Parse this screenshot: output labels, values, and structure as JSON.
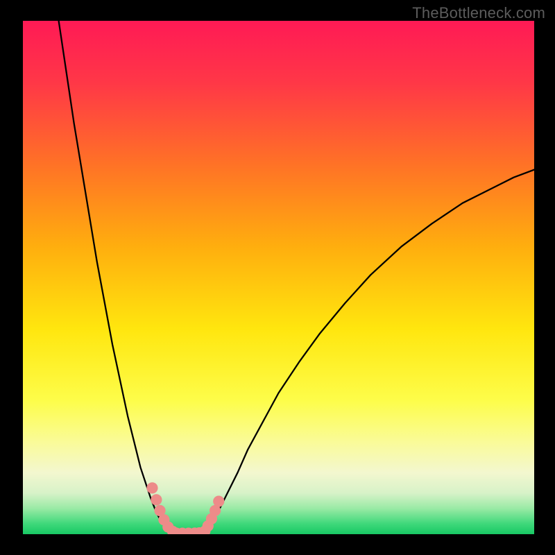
{
  "watermark": "TheBottleneck.com",
  "chart_data": {
    "type": "line",
    "title": "",
    "xlabel": "",
    "ylabel": "",
    "xlim": [
      0,
      100
    ],
    "ylim": [
      0,
      100
    ],
    "grid": false,
    "legend": false,
    "background": {
      "kind": "vertical-gradient",
      "stops": [
        {
          "pct": 0,
          "color": "#ff1a55"
        },
        {
          "pct": 12,
          "color": "#ff3747"
        },
        {
          "pct": 28,
          "color": "#ff7226"
        },
        {
          "pct": 44,
          "color": "#ffae0e"
        },
        {
          "pct": 60,
          "color": "#ffe60e"
        },
        {
          "pct": 74,
          "color": "#fdfd4a"
        },
        {
          "pct": 82,
          "color": "#fafb98"
        },
        {
          "pct": 88,
          "color": "#f3f7cf"
        },
        {
          "pct": 92,
          "color": "#d7f2c8"
        },
        {
          "pct": 95,
          "color": "#99eaa5"
        },
        {
          "pct": 98,
          "color": "#3ed87a"
        },
        {
          "pct": 100,
          "color": "#18c864"
        }
      ]
    },
    "series": [
      {
        "name": "curve-left",
        "color": "#000000",
        "x": [
          7.0,
          8.5,
          10.0,
          11.5,
          13.0,
          14.5,
          16.0,
          17.5,
          19.0,
          20.5,
          22.0,
          23.0,
          24.0,
          25.0,
          26.0,
          27.0,
          28.0,
          29.0,
          30.0
        ],
        "y": [
          100,
          90,
          80,
          71,
          62,
          53,
          45,
          37,
          30,
          23,
          17,
          13,
          10,
          7,
          4.5,
          2.5,
          1.2,
          0.4,
          0.0
        ]
      },
      {
        "name": "curve-right",
        "color": "#000000",
        "x": [
          35.0,
          36.0,
          37.0,
          38.5,
          40.0,
          42.0,
          44.0,
          47.0,
          50.0,
          54.0,
          58.0,
          63.0,
          68.0,
          74.0,
          80.0,
          86.0,
          92.0,
          96.0,
          100.0
        ],
        "y": [
          0.0,
          1.0,
          2.5,
          5.0,
          8.0,
          12.0,
          16.5,
          22.0,
          27.5,
          33.5,
          39.0,
          45.0,
          50.5,
          56.0,
          60.5,
          64.5,
          67.5,
          69.5,
          71.0
        ]
      }
    ],
    "markers": [
      {
        "name": "left-dots",
        "color": "#ed8b89",
        "shape": "circle",
        "r": 1.1,
        "points": [
          {
            "x": 25.3,
            "y": 9.0
          },
          {
            "x": 26.1,
            "y": 6.7
          },
          {
            "x": 26.8,
            "y": 4.6
          },
          {
            "x": 27.6,
            "y": 2.8
          },
          {
            "x": 28.4,
            "y": 1.4
          },
          {
            "x": 29.3,
            "y": 0.55
          }
        ]
      },
      {
        "name": "right-dots",
        "color": "#ed8b89",
        "shape": "circle",
        "r": 1.1,
        "points": [
          {
            "x": 35.6,
            "y": 0.6
          },
          {
            "x": 36.2,
            "y": 1.6
          },
          {
            "x": 36.9,
            "y": 3.0
          },
          {
            "x": 37.6,
            "y": 4.6
          },
          {
            "x": 38.3,
            "y": 6.4
          }
        ]
      },
      {
        "name": "floor-dots",
        "color": "#ed8b89",
        "shape": "circle",
        "r": 1.1,
        "points": [
          {
            "x": 30.0,
            "y": 0.2
          },
          {
            "x": 31.2,
            "y": 0.18
          },
          {
            "x": 32.4,
            "y": 0.18
          },
          {
            "x": 33.6,
            "y": 0.2
          },
          {
            "x": 34.5,
            "y": 0.25
          }
        ]
      }
    ]
  }
}
